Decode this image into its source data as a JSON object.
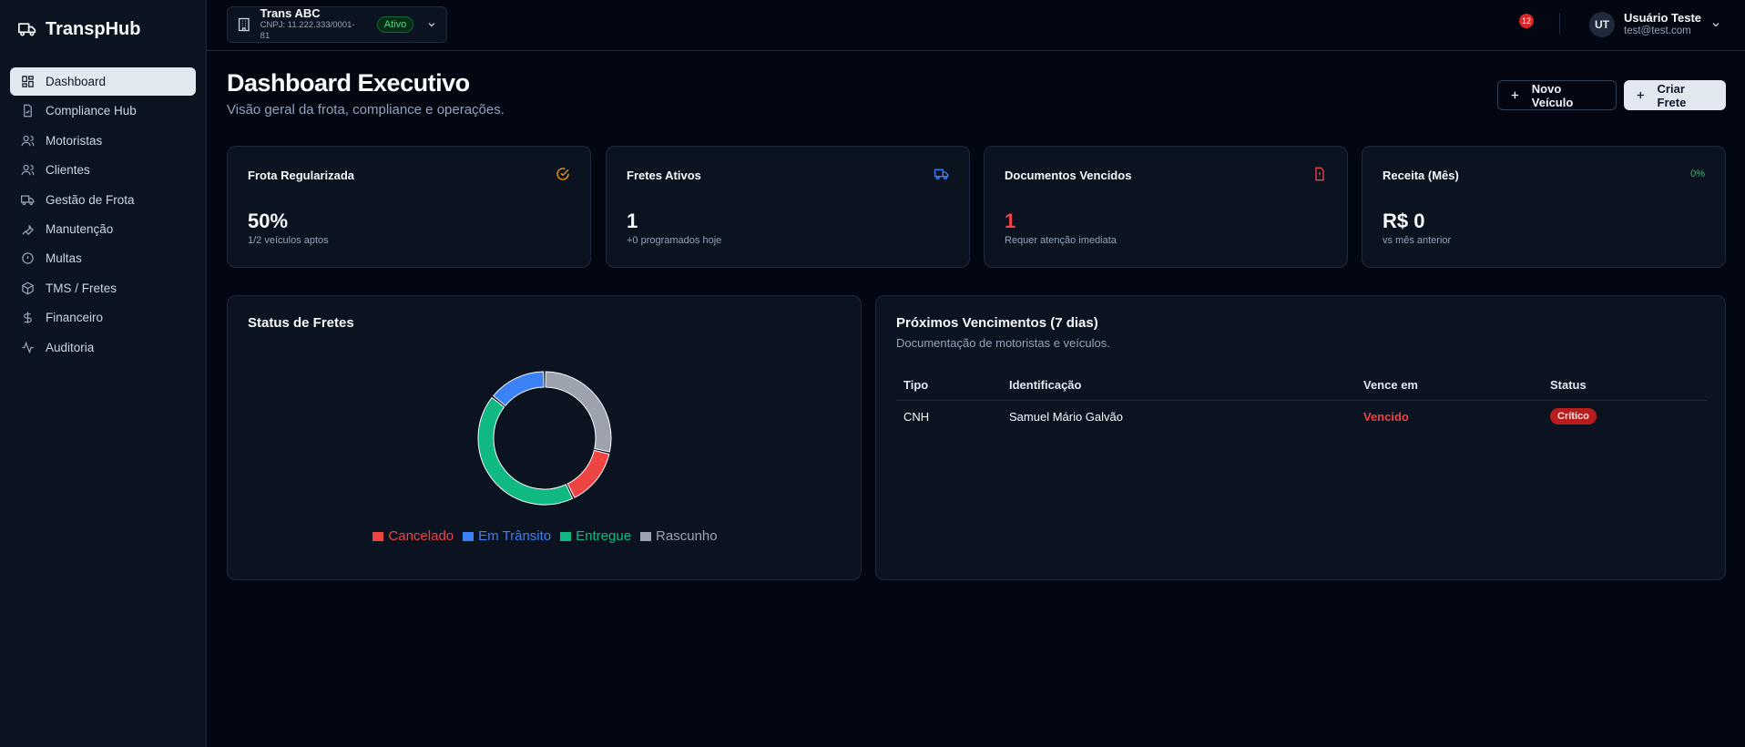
{
  "app": {
    "name": "TranspHub"
  },
  "sidebar": {
    "items": [
      {
        "label": "Dashboard",
        "icon": "dashboard-icon",
        "active": true
      },
      {
        "label": "Compliance Hub",
        "icon": "file-check-icon"
      },
      {
        "label": "Motoristas",
        "icon": "users-icon"
      },
      {
        "label": "Clientes",
        "icon": "users-icon"
      },
      {
        "label": "Gestão de Frota",
        "icon": "truck-icon"
      },
      {
        "label": "Manutenção",
        "icon": "wrench-icon"
      },
      {
        "label": "Multas",
        "icon": "alert-circle-icon"
      },
      {
        "label": "TMS / Fretes",
        "icon": "package-icon"
      },
      {
        "label": "Financeiro",
        "icon": "dollar-icon"
      },
      {
        "label": "Auditoria",
        "icon": "activity-icon"
      }
    ]
  },
  "topbar": {
    "company_name": "Trans ABC",
    "company_cnpj": "CNPJ: 11.222.333/0001-81",
    "company_status": "Ativo",
    "notifications": "12",
    "user_initials": "UT",
    "user_name": "Usuário Teste",
    "user_email": "test@test.com"
  },
  "header": {
    "title": "Dashboard Executivo",
    "subtitle": "Visão geral da frota, compliance e operações.",
    "btn_new_vehicle": "Novo Veículo",
    "btn_new_freight": "Criar Frete"
  },
  "cards": [
    {
      "title": "Frota Regularizada",
      "value": "50%",
      "note": "1/2 veículos aptos",
      "icon": "check-circle-icon",
      "icon_color": "#f59e0b"
    },
    {
      "title": "Fretes Ativos",
      "value": "1",
      "note": "+0 programados hoje",
      "icon": "truck-icon",
      "icon_color": "#3b82f6"
    },
    {
      "title": "Documentos Vencidos",
      "value": "1",
      "note": "Requer atenção imediata",
      "icon": "file-alert-icon",
      "icon_color": "#ef4444",
      "value_color": "#ef4444"
    },
    {
      "title": "Receita (Mês)",
      "value": "R$ 0",
      "note": "vs mês anterior",
      "badge": "0%"
    }
  ],
  "freight_status": {
    "title": "Status de Fretes"
  },
  "chart_data": {
    "type": "pie",
    "variant": "donut",
    "categories": [
      "Cancelado",
      "Em Trânsito",
      "Entregue",
      "Rascunho"
    ],
    "values": [
      1,
      1,
      3,
      2
    ],
    "colors": [
      "#ef4444",
      "#3b82f6",
      "#10b981",
      "#9ca3af"
    ],
    "legend": "bottom"
  },
  "expirations": {
    "title": "Próximos Vencimentos (7 dias)",
    "subtitle": "Documentação de motoristas e veículos.",
    "columns": [
      "Tipo",
      "Identificação",
      "Vence em",
      "Status"
    ],
    "rows": [
      {
        "tipo": "CNH",
        "ident": "Samuel Mário Galvão",
        "vence": "Vencido",
        "status": "Crítico"
      }
    ]
  }
}
